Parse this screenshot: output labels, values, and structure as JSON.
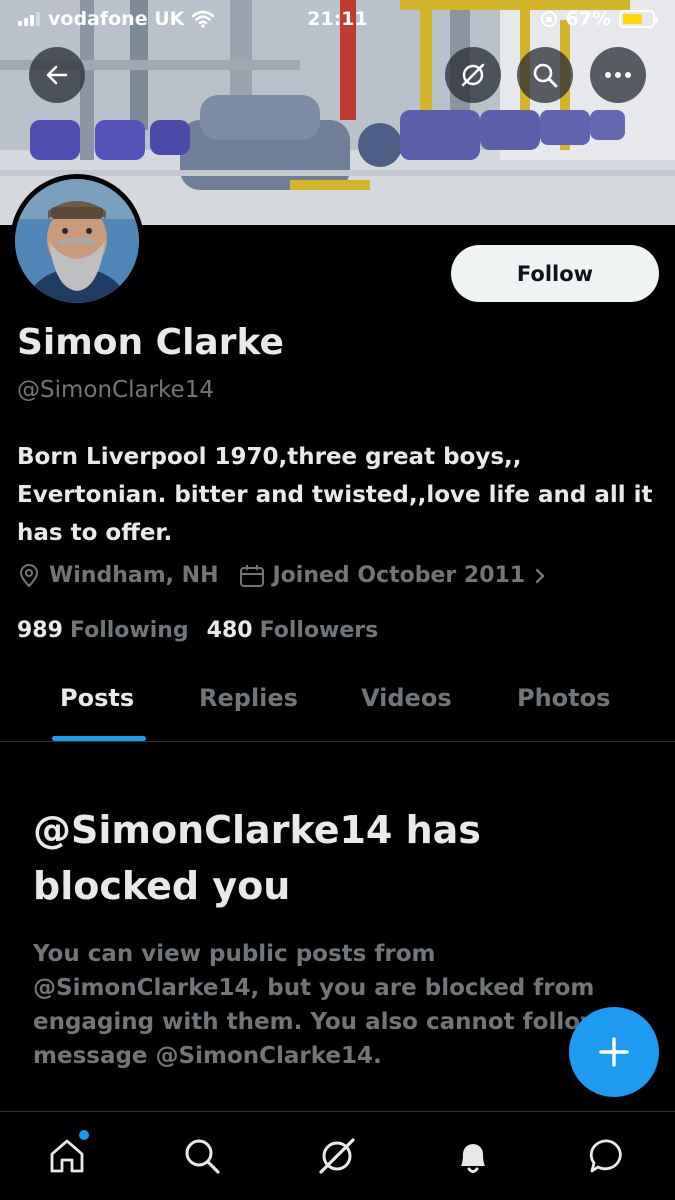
{
  "status_bar": {
    "carrier": "vodafone UK",
    "time": "21:11",
    "battery_percent": "67%",
    "battery_level": 0.67
  },
  "profile": {
    "name": "Simon Clarke",
    "handle": "@SimonClarke14",
    "bio": "Born Liverpool 1970,three great boys,, Evertonian. bitter and twisted,,love life and all it has to offer.",
    "location": "Windham, NH",
    "joined": "Joined October 2011",
    "following_count": "989",
    "following_label": "Following",
    "followers_count": "480",
    "followers_label": "Followers",
    "follow_button": "Follow"
  },
  "tabs": [
    {
      "label": "Posts",
      "active": true
    },
    {
      "label": "Replies",
      "active": false
    },
    {
      "label": "Videos",
      "active": false
    },
    {
      "label": "Photos",
      "active": false
    }
  ],
  "blocked": {
    "title": "@SimonClarke14 has blocked you",
    "message": "You can view public posts from @SimonClarke14, but you are blocked from engaging with them. You also cannot follow or message @SimonClarke14."
  },
  "icons": {
    "back": "back-arrow-icon",
    "grok": "grok-icon",
    "search": "search-icon",
    "more": "more-icon",
    "compose": "plus-icon",
    "home": "home-icon",
    "explore": "search-icon",
    "grok_nav": "grok-icon",
    "notifications": "bell-icon",
    "messages": "message-icon"
  },
  "colors": {
    "accent": "#1d9bf0",
    "background": "#000000",
    "secondary_text": "#71767b",
    "battery": "#ffd60a"
  }
}
